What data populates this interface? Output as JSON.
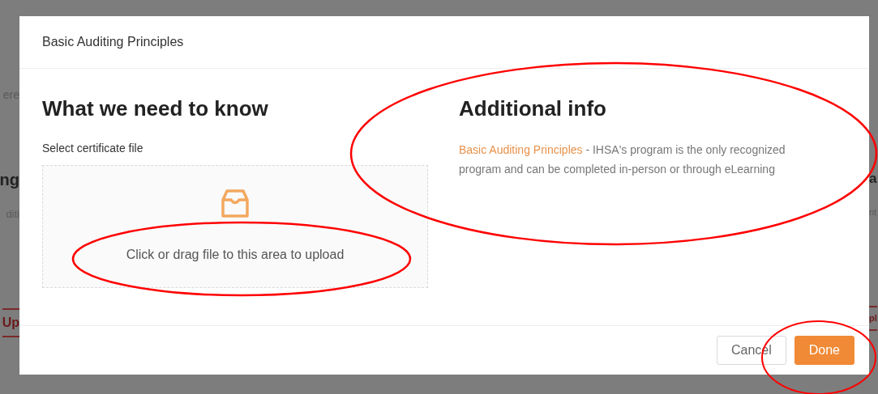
{
  "background": {
    "left_fragments": [
      "ere",
      "ng",
      "diti",
      "Up"
    ],
    "right_fragments": [
      "a",
      "nt",
      "pl"
    ]
  },
  "dialog": {
    "title": "Basic Auditing Principles",
    "left": {
      "heading": "What we need to know",
      "label": "Select certificate file",
      "upload_hint": "Click or drag file to this area to upload"
    },
    "right": {
      "heading": "Additional info",
      "link": "Basic Auditing Principles",
      "text": " - IHSA's program is the only recognized program and can be completed in-person or through eLearning"
    },
    "buttons": [
      {
        "label": "Cancel",
        "kind": "secondary"
      },
      {
        "label": "Done",
        "kind": "primary"
      }
    ]
  }
}
